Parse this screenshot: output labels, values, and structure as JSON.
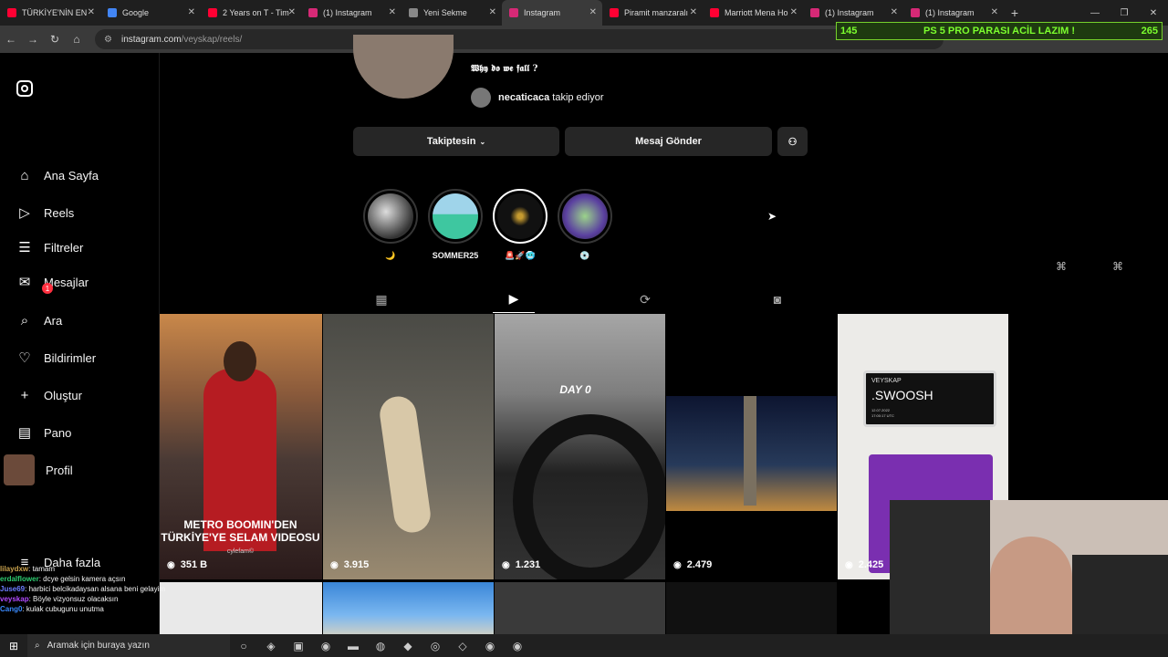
{
  "browser": {
    "tabs": [
      {
        "label": "TÜRKİYE'NİN EN",
        "color": "#ff0033",
        "active": false
      },
      {
        "label": "Google",
        "color": "#4285f4",
        "active": false
      },
      {
        "label": "2 Years on T - Tim",
        "color": "#ff0033",
        "active": false
      },
      {
        "label": "(1) Instagram",
        "color": "#d62976",
        "active": false
      },
      {
        "label": "Yeni Sekme",
        "color": "#888888",
        "active": false
      },
      {
        "label": "Instagram",
        "color": "#d62976",
        "active": true
      },
      {
        "label": "Piramit manzaralı",
        "color": "#ff0033",
        "active": false
      },
      {
        "label": "Marriott Mena Ho",
        "color": "#ff0033",
        "active": false
      },
      {
        "label": "(1) Instagram",
        "color": "#d62976",
        "active": false
      },
      {
        "label": "(1) Instagram",
        "color": "#d62976",
        "active": false
      }
    ],
    "new_tab_label": "+",
    "url_host": "instagram.com",
    "url_path": "/veyskap/reels/"
  },
  "overlay": {
    "left": "145",
    "text": "PS 5 PRO PARASI ACİL LAZIM !",
    "right": "265"
  },
  "sidebar": {
    "items": [
      {
        "label": "Ana Sayfa",
        "icon": "home-icon"
      },
      {
        "label": "Reels",
        "icon": "reels-icon"
      },
      {
        "label": "Filtreler",
        "icon": "filter-icon"
      },
      {
        "label": "Mesajlar",
        "icon": "messages-icon",
        "badge": "1"
      },
      {
        "label": "Ara",
        "icon": "search-icon"
      },
      {
        "label": "Bildirimler",
        "icon": "heart-icon"
      },
      {
        "label": "Oluştur",
        "icon": "plus-icon"
      },
      {
        "label": "Pano",
        "icon": "dashboard-icon"
      },
      {
        "label": "Profil",
        "icon": "avatar"
      },
      {
        "label": "Daha fazla",
        "icon": "menu-icon"
      }
    ]
  },
  "profile": {
    "bio": "𝖂𝖍𝖞 𝖉𝖔 𝖜𝖊 𝖋𝖆𝖑𝖑 ?",
    "followed_by_user": "necaticaca",
    "followed_by_text": "takip ediyor",
    "follow_button": "Takiptesin",
    "message_button": "Mesaj Gönder"
  },
  "highlights": [
    {
      "label": "🌙"
    },
    {
      "label": "SOMMER25"
    },
    {
      "label": "🚨🚀🥶"
    },
    {
      "label": "💿"
    }
  ],
  "reels": [
    {
      "views": "351 B",
      "caption": "METRO BOOMIN'DEN TÜRKİYE'YE SELAM VIDEOSU",
      "sub": "cylefam©"
    },
    {
      "views": "3.915",
      "caption": "",
      "sub": ""
    },
    {
      "views": "1.231",
      "caption": "DAY 0",
      "sub": ""
    },
    {
      "views": "2.479",
      "caption": "",
      "sub": ""
    },
    {
      "views": "2.425",
      "caption": "",
      "sub": ""
    }
  ],
  "reel5_card": {
    "brand": "VEYSKAP",
    "title": ".SWOOSH",
    "date": "12.07.2022",
    "time": "17:00:17 UTC"
  },
  "chat": [
    {
      "user": "lilaydxw",
      "msg": ": tamam",
      "color": "#c9a24d"
    },
    {
      "user": "erdalflower",
      "msg": ": dcye gelsin kamera açsın",
      "color": "#2ecc71"
    },
    {
      "user": "Juse69",
      "msg": ": harbici belcikadaysan alsana beni gelayim",
      "color": "#6c7cff"
    },
    {
      "user": "veyskap",
      "msg": ": Böyle vizyonsuz olacaksın",
      "color": "#b14aff"
    },
    {
      "user": "Cang0",
      "msg": ": kulak cubugunu unutma",
      "color": "#3a8bff"
    }
  ],
  "taskbar": {
    "search_placeholder": "Aramak için buraya yazın"
  }
}
